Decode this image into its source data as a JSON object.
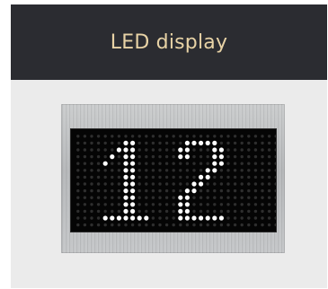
{
  "header": {
    "title": "LED display"
  },
  "led_display": {
    "value": "12",
    "lit_color": "#ffffff",
    "dim_color": "#2e2e2e",
    "background": "#050505"
  },
  "colors": {
    "header_bg": "#2b2c31",
    "header_text": "#e8d3a6",
    "card_bg": "#ebebeb",
    "plate": "#bfc1c3"
  }
}
